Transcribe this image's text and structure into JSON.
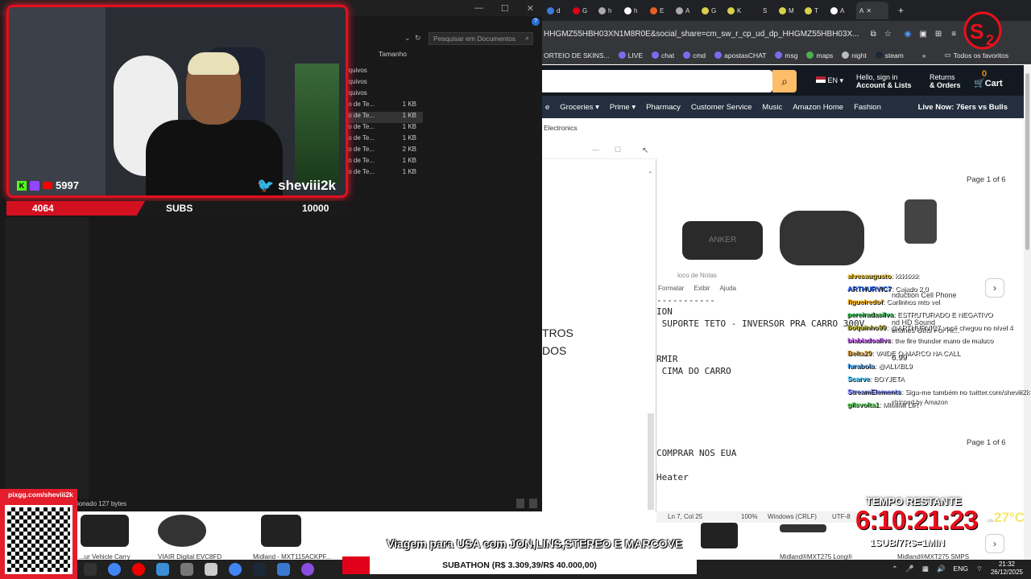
{
  "explorer": {
    "search_placeholder": "Pesquisar em Documentos",
    "column_size": "Tamanho",
    "rows": [
      {
        "name": "rquivos",
        "size": ""
      },
      {
        "name": "rquivos",
        "size": ""
      },
      {
        "name": "rquivos",
        "size": ""
      },
      {
        "name": "to de Te...",
        "size": "1 KB"
      },
      {
        "name": "to de Te...",
        "size": "1 KB"
      },
      {
        "name": "to de Te...",
        "size": "1 KB"
      },
      {
        "name": "to de Te...",
        "size": "1 KB"
      },
      {
        "name": "to de Te...",
        "size": "2 KB"
      },
      {
        "name": "to de Te...",
        "size": "1 KB"
      },
      {
        "name": "to de Te...",
        "size": "1 KB"
      }
    ],
    "status": "ionado  127 bytes"
  },
  "browser": {
    "tabs": [
      "d",
      "G",
      "h",
      "h",
      "E",
      "A",
      "G",
      "K",
      "S",
      "M",
      "T",
      "A",
      "A"
    ],
    "url": "HHGMZ55HBH03XN1M8R0E&social_share=cm_sw_r_cp_ud_dp_HHGMZ55HBH03X...",
    "bookmarks": [
      "ORTEIO DE SKINS...",
      "LIVE",
      "chat",
      "cmd",
      "apostasCHAT",
      "msg",
      "maps",
      "night",
      "steam"
    ],
    "bookmarks_all": "Todos os favoritos"
  },
  "amazon": {
    "lang": "EN",
    "account_line1": "Hello, sign in",
    "account_line2": "Account & Lists",
    "returns_line1": "Returns",
    "returns_line2": "& Orders",
    "cart_count": "0",
    "cart_label": "Cart",
    "nav": [
      "e",
      "Groceries",
      "Prime",
      "Pharmacy",
      "Customer Service",
      "Music",
      "Amazon Home",
      "Fashion"
    ],
    "live": "Live Now: 76ers vs Bulls",
    "crumb": "Electronics",
    "page_info": "Page 1 of 6",
    "page_info_bottom": "Page 1 of 6",
    "price": "6.99",
    "shipped_by": "shipped by Amazon",
    "product_lines": [
      "nduction Cell Phone",
      "nd HD Sound",
      "entines Gifts For Hi..."
    ]
  },
  "notepad": {
    "title": "loco de Notas",
    "menu": [
      "Formatar",
      "Exibir",
      "Ajuda"
    ],
    "left_lines": [
      "TROS",
      "DOS"
    ],
    "lines": [
      "-----------",
      "ION",
      " SUPORTE TETO - INVERSOR PRA CARRO 300V",
      "",
      "RMIR",
      " CIMA DO CARRO",
      "COMPRAR NOS EUA",
      "Heater"
    ],
    "status_pos": "Ln 7, Col 25",
    "status_zoom": "100%",
    "status_eol": "Windows (CRLF)",
    "status_enc": "UTF-8"
  },
  "stream": {
    "viewers": "5997",
    "handle": "sheviii2k",
    "subs_current": "4064",
    "subs_label": "SUBS",
    "subs_goal": "10000",
    "subs_progress_percent": 40.6,
    "qr_label": "pixgg.com/sheviii2k",
    "timer_label": "TEMPO RESTANTE",
    "timer": "6:10:21:23",
    "timer_sub": "1SUB/7R$=1MIN",
    "temp": "27°C",
    "caption": "Viagem para USA com JON,LINS,STEREO E MARCOVE",
    "subathon": "SUBATHON (R$ 3.309,39/R$ 40.000,00)"
  },
  "chat": [
    {
      "user": "alvesaugusto",
      "text": ": kkkkkkk",
      "color": "#e7b400"
    },
    {
      "user": "ARTHURVIC7",
      "text": ": Cajado 2.0",
      "color": "#2f6dff"
    },
    {
      "user": "figueiredof",
      "text": ": Carlinhos mto vel",
      "color": "#ffb200"
    },
    {
      "user": "pereiradasilva",
      "text": ": ESTRUTURADO E NEGATIVO",
      "color": "#2db34a"
    },
    {
      "user": "boquinho99",
      "text": ": @ARTHURVIC7 você chegou no nível 4",
      "color": "#b0ad1a"
    },
    {
      "user": "biabiadoalivs",
      "text": ": the fire thunder mano de maluco",
      "color": "#b75be0"
    },
    {
      "user": "Belta29",
      "text": ": VAIDE O MARCO NA CALL",
      "color": "#e2a63c"
    },
    {
      "user": "furabola",
      "text": ": @ALIXBL9",
      "color": "#3fa6ff"
    },
    {
      "user": "Scarve",
      "text": ": BOYJETA",
      "color": "#4ac6ff"
    },
    {
      "user": "StreamElements",
      "text": ": Siga-me também no twitter.com/sheviii2k",
      "color": "#6a78ff"
    },
    {
      "user": "gilsvolta1",
      "text": ": MIMIMI LIR",
      "color": "#5ad15a"
    }
  ],
  "strip": {
    "captions": [
      "...ur Vehicle Carry",
      "VIAIR Digital EVC8FD",
      "Midland - MXT115ACKPF...",
      "Midland®MXT275 Long®",
      "Midland®MXT275 SMPS"
    ]
  },
  "tray": {
    "lang": "ENG",
    "time": "21:32",
    "date": "26/12/2025"
  }
}
